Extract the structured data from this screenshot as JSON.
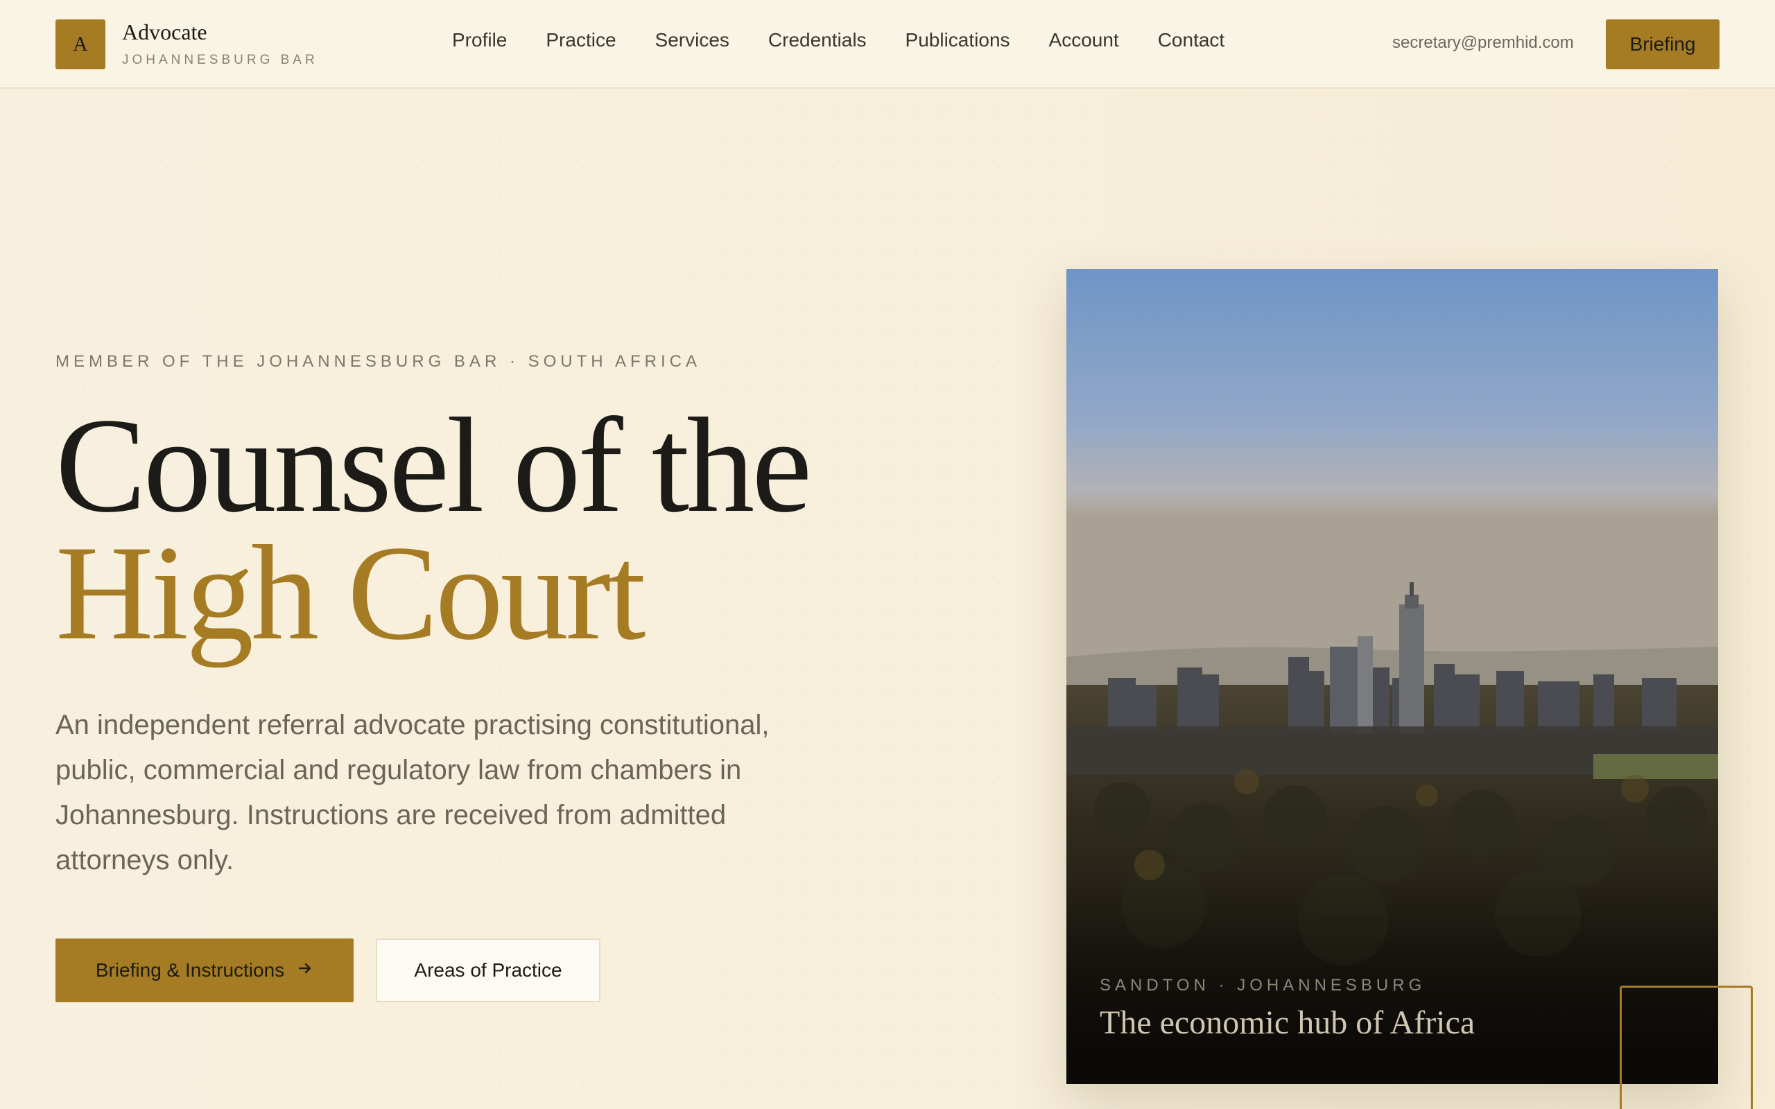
{
  "brand": {
    "mark": "A",
    "name": "Advocate",
    "subtitle": "JOHANNESBURG BAR"
  },
  "nav": {
    "items": [
      {
        "label": "Profile"
      },
      {
        "label": "Practice"
      },
      {
        "label": "Services"
      },
      {
        "label": "Credentials"
      },
      {
        "label": "Publications"
      },
      {
        "label": "Account"
      },
      {
        "label": "Contact"
      }
    ]
  },
  "header": {
    "email": "secretary@premhid.com",
    "cta_label": "Briefing"
  },
  "hero": {
    "eyebrow": "MEMBER OF THE JOHANNESBURG BAR · SOUTH AFRICA",
    "headline_line1": "Counsel of the",
    "headline_line2": "High Court",
    "lede": "An independent referral advocate practising constitutional, public, commercial and regulatory law from chambers in Johannesburg. Instructions are received from admitted attorneys only.",
    "primary_button": "Briefing & Instructions",
    "secondary_button": "Areas of Practice"
  },
  "photo": {
    "kicker": "SANDTON · JOHANNESBURG",
    "caption": "The economic hub of Africa"
  },
  "colors": {
    "accent": "#a57c24",
    "background": "#f8f0de",
    "ink": "#1d1b17"
  },
  "icons": {
    "primary_button_icon": "arrow-right-icon"
  }
}
